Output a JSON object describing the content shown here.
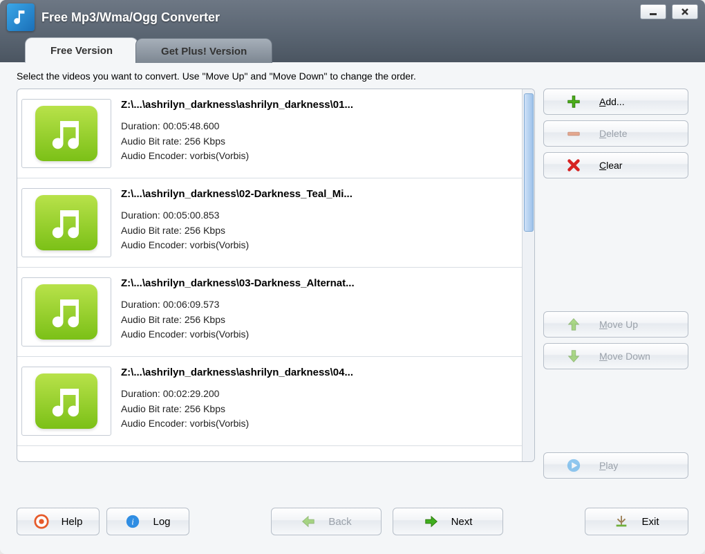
{
  "app_title": "Free Mp3/Wma/Ogg Converter",
  "tabs": {
    "free": "Free Version",
    "plus": "Get Plus! Version"
  },
  "instruction": "Select the videos you want to convert. Use \"Move Up\" and \"Move Down\" to change the order.",
  "items": [
    {
      "path": "Z:\\...\\ashrilyn_darkness\\ashrilyn_darkness\\01...",
      "duration_label": "Duration:",
      "duration": "00:05:48.600",
      "bitrate_label": "Audio Bit rate:",
      "bitrate": "256 Kbps",
      "encoder_label": "Audio Encoder:",
      "encoder": "vorbis(Vorbis)"
    },
    {
      "path": "Z:\\...\\ashrilyn_darkness\\02-Darkness_Teal_Mi...",
      "duration_label": "Duration:",
      "duration": "00:05:00.853",
      "bitrate_label": "Audio Bit rate:",
      "bitrate": "256 Kbps",
      "encoder_label": "Audio Encoder:",
      "encoder": "vorbis(Vorbis)"
    },
    {
      "path": "Z:\\...\\ashrilyn_darkness\\03-Darkness_Alternat...",
      "duration_label": "Duration:",
      "duration": "00:06:09.573",
      "bitrate_label": "Audio Bit rate:",
      "bitrate": "256 Kbps",
      "encoder_label": "Audio Encoder:",
      "encoder": "vorbis(Vorbis)"
    },
    {
      "path": "Z:\\...\\ashrilyn_darkness\\ashrilyn_darkness\\04...",
      "duration_label": "Duration:",
      "duration": "00:02:29.200",
      "bitrate_label": "Audio Bit rate:",
      "bitrate": "256 Kbps",
      "encoder_label": "Audio Encoder:",
      "encoder": "vorbis(Vorbis)"
    }
  ],
  "side": {
    "add": "Add...",
    "delete": "Delete",
    "clear": "Clear",
    "move_up": "Move Up",
    "move_down": "Move Down",
    "play": "Play"
  },
  "footer": {
    "help": "Help",
    "log": "Log",
    "back": "Back",
    "next": "Next",
    "exit": "Exit"
  }
}
